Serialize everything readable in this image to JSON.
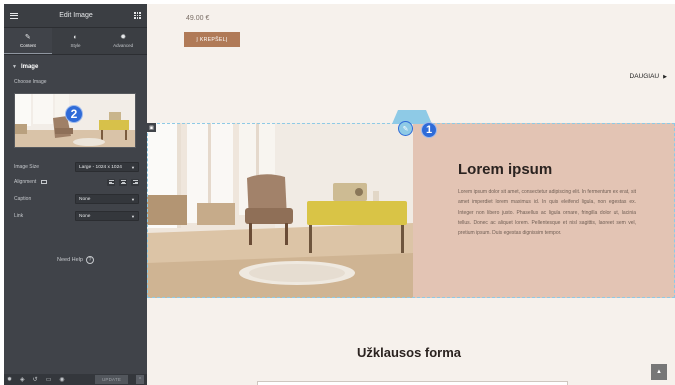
{
  "panel": {
    "title": "Edit Image",
    "tabs": [
      {
        "label": "Content",
        "icon": "pencil-icon"
      },
      {
        "label": "Style",
        "icon": "contrast-icon"
      },
      {
        "label": "Advanced",
        "icon": "gear-icon"
      }
    ],
    "section_title": "Image",
    "choose_image_label": "Choose Image",
    "image_size_label": "Image Size",
    "image_size_value": "Large - 1024 x 1024",
    "alignment_label": "Alignment",
    "caption_label": "Caption",
    "caption_value": "None",
    "link_label": "Link",
    "link_value": "None",
    "need_help": "Need Help",
    "update_label": "UPDATE"
  },
  "canvas": {
    "price": "49.00 €",
    "cart_button": "Į KREPŠELĮ",
    "more_link": "DAUGIAU",
    "heading": "Lorem ipsum",
    "body": "Lorem ipsum dolor sit amet, consectetur adipiscing elit. In fermentum ex erat, sit amet imperdiet lorem maximus id. In quis eleifend ligula, non egestas ex. Integer non libero justo. Phasellus ac ligula ornare, fringilla dolor ut, lacinia tellus. Donec ac aliquet lorem. Pellentesque et nisl sagittis, laoreet sem vel, pretium ipsum. Duis egestas dignissim tempor.",
    "form_title": "Užklausos forma"
  },
  "markers": {
    "one": "1",
    "two": "2"
  },
  "colors": {
    "panel_bg": "#404349",
    "accent_blue": "#2f6bd8",
    "outline_cyan": "#8ecae6",
    "terracotta": "#e3c4b4",
    "cart_button": "#b07a57",
    "page_bg": "#f6f1ec"
  }
}
